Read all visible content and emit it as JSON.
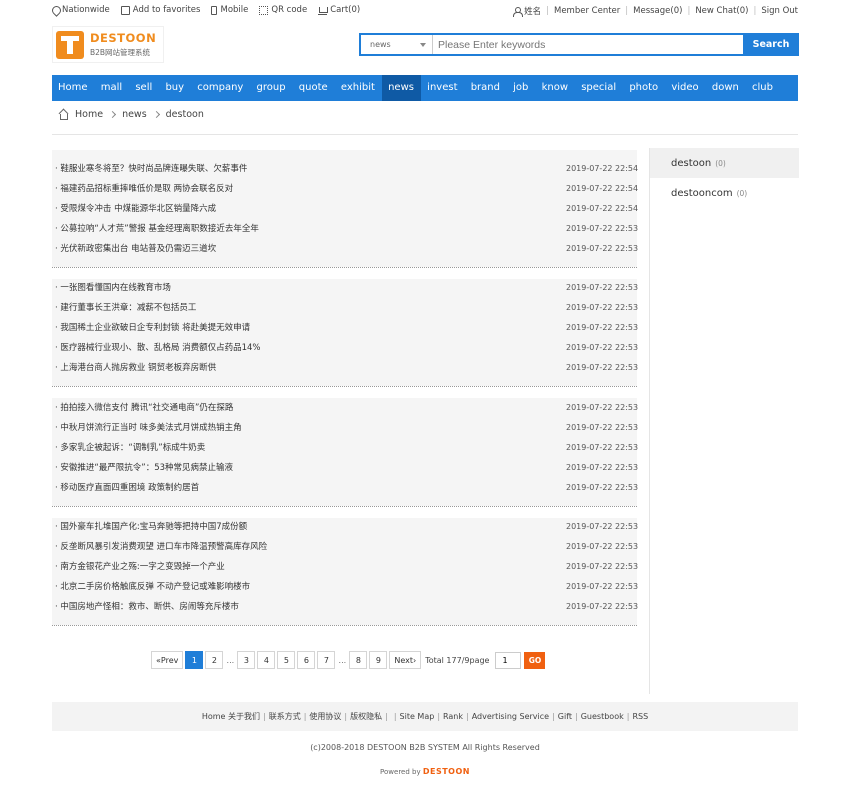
{
  "topbar": {
    "left": [
      {
        "icon": "location-pin-icon",
        "label": "Nationwide"
      },
      {
        "icon": "favorites-icon",
        "label": "Add to favorites"
      },
      {
        "icon": "mobile-icon",
        "label": "Mobile"
      },
      {
        "icon": "qr-code-icon",
        "label": "QR code"
      },
      {
        "icon": "cart-icon",
        "label": "Cart(0)"
      }
    ],
    "user_name": "姓名",
    "member_center": "Member Center",
    "message": "Message(0)",
    "new_chat": "New Chat(0)",
    "sign_out": "Sign Out"
  },
  "logo": {
    "name": "DESTOON",
    "subtitle": "B2B网站管理系统",
    "color": "#f08c1e"
  },
  "search": {
    "module": "news",
    "placeholder": "Please Enter keywords",
    "button": "Search"
  },
  "nav": {
    "items": [
      "Home",
      "mall",
      "sell",
      "buy",
      "company",
      "group",
      "quote",
      "exhibit",
      "news",
      "invest",
      "brand",
      "job",
      "know",
      "special",
      "photo",
      "video",
      "down",
      "club"
    ],
    "active": "news",
    "color": "#1f7ed8"
  },
  "breadcrumb": [
    "Home",
    "news",
    "destoon"
  ],
  "news_groups": [
    [
      {
        "title": "· 鞋服业寒冬将至？快时尚品牌连曝失联、欠薪事件",
        "date": "2019-07-22 22:54"
      },
      {
        "title": "· 福建药品招标重摔唯低价是取 两协会联名反对",
        "date": "2019-07-22 22:54"
      },
      {
        "title": "· 受限煤令冲击 中煤能源华北区销量降六成",
        "date": "2019-07-22 22:54"
      },
      {
        "title": "· 公募拉响“人才荒”警报 基金经理离职数接近去年全年",
        "date": "2019-07-22 22:53"
      },
      {
        "title": "· 光伏新政密集出台 电站普及仍需迈三道坎",
        "date": "2019-07-22 22:53"
      }
    ],
    [
      {
        "title": "· 一张图看懂国内在线教育市场",
        "date": "2019-07-22 22:53"
      },
      {
        "title": "· 建行董事长王洪章：减薪不包括员工",
        "date": "2019-07-22 22:53"
      },
      {
        "title": "· 我国稀土企业欲破日企专利封锁 将赴美提无效申请",
        "date": "2019-07-22 22:53"
      },
      {
        "title": "· 医疗器械行业现小、散、乱格局 消费额仅占药品14%",
        "date": "2019-07-22 22:53"
      },
      {
        "title": "· 上海港台商人抛房救业 铜贸老板弃房断供",
        "date": "2019-07-22 22:53"
      }
    ],
    [
      {
        "title": "· 拍拍接入微信支付 腾讯“社交通电商”仍在探路",
        "date": "2019-07-22 22:53"
      },
      {
        "title": "· 中秋月饼流行正当时 味多美法式月饼成热销主角",
        "date": "2019-07-22 22:53"
      },
      {
        "title": "· 多家乳企被起诉：“调制乳”标成牛奶卖",
        "date": "2019-07-22 22:53"
      },
      {
        "title": "· 安徽推进“最严限抗令”：53种常见病禁止输液",
        "date": "2019-07-22 22:53"
      },
      {
        "title": "· 移动医疗直面四重困境 政策制约居首",
        "date": "2019-07-22 22:53"
      }
    ],
    [
      {
        "title": "· 国外豪车扎堆国产化:宝马奔驰等把持中国7成份额",
        "date": "2019-07-22 22:53"
      },
      {
        "title": "· 反垄断风暴引发消费观望 进口车市降温预警高库存风险",
        "date": "2019-07-22 22:53"
      },
      {
        "title": "· 南方金银花产业之殇:一字之变毁掉一个产业",
        "date": "2019-07-22 22:53"
      },
      {
        "title": "· 北京二手房价格触底反弹 不动产登记或难影响楼市",
        "date": "2019-07-22 22:53"
      },
      {
        "title": "· 中国房地产怪相：救市、断供、房闹等充斥楼市",
        "date": "2019-07-22 22:53"
      }
    ]
  ],
  "pagination": {
    "prev": "«Prev",
    "pages": [
      "1",
      "2",
      "...",
      "3",
      "4",
      "5",
      "6",
      "7",
      "...",
      "8",
      "9"
    ],
    "current": "1",
    "next": "Next›",
    "total": "Total 177/9page",
    "input_value": "1",
    "go": "GO",
    "go_color": "#f06010"
  },
  "sidebar": [
    {
      "label": "destoon",
      "count": "(0)"
    },
    {
      "label": "destooncom",
      "count": "(0)"
    }
  ],
  "footer": {
    "links": [
      "Home 关于我们",
      "联系方式",
      "使用协议",
      "版权隐私",
      "",
      "Site Map",
      "Rank",
      "Advertising Service",
      "Gift",
      "Guestbook",
      "RSS"
    ],
    "copyright": "(c)2008-2018 DESTOON B2B SYSTEM All Rights Reserved",
    "powered_label": "Powered by",
    "powered_brand": "DESTOON"
  }
}
